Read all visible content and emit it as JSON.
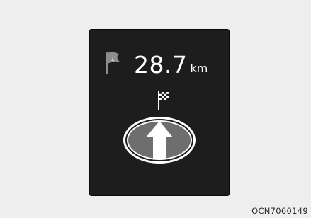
{
  "display": {
    "waypoint_number": "1",
    "distance_value": "28.7",
    "distance_unit": "km",
    "waypoint_icon": "waypoint-flag-icon",
    "destination_icon": "checkered-flag-icon",
    "direction_icon": "straight-arrow-icon"
  },
  "caption": {
    "code": "OCN7060149"
  },
  "colors": {
    "page_background": "#eeeeee",
    "screen_background": "#1d1d1d",
    "text": "#ffffff",
    "flag_gray": "#8c8c8c"
  }
}
